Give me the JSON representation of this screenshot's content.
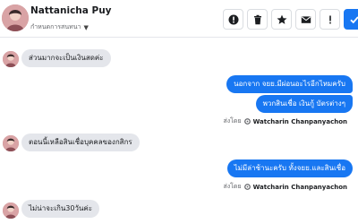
{
  "header": {
    "contact_name": "Nattanicha Puy",
    "status_text": "กำหนดการสนทนา",
    "icons": [
      "alert-icon",
      "trash-icon",
      "star-icon",
      "mail-icon",
      "exclamation-icon",
      "check-icon"
    ]
  },
  "messages": [
    {
      "direction": "in",
      "text": "ส่วนมากจะเป็นเงินสดค่ะ"
    },
    {
      "direction": "out",
      "text": "นอกจาก จยย.มีผ่อนอะไรอีกไหมครับ"
    },
    {
      "direction": "out",
      "text": "พวกสินเชื่อ เงินกู้ บัตรต่างๆ"
    },
    {
      "direction": "in",
      "text": "ตอนนี้เหลือสินเชื่อบุคคลของกสิกร"
    },
    {
      "direction": "out",
      "text": "ไม่มีล่าช้านะครับ ทั้งจยย.และสินเชื่อ"
    },
    {
      "direction": "in",
      "text": "ไม่น่าจะเกิน30วันค่ะ"
    }
  ],
  "sent_by": {
    "prefix": "ส่งโดย",
    "name": "Watcharin Chanpanyachon"
  },
  "colors": {
    "accent": "#1877f2",
    "incoming_bubble": "#e4e6eb"
  }
}
